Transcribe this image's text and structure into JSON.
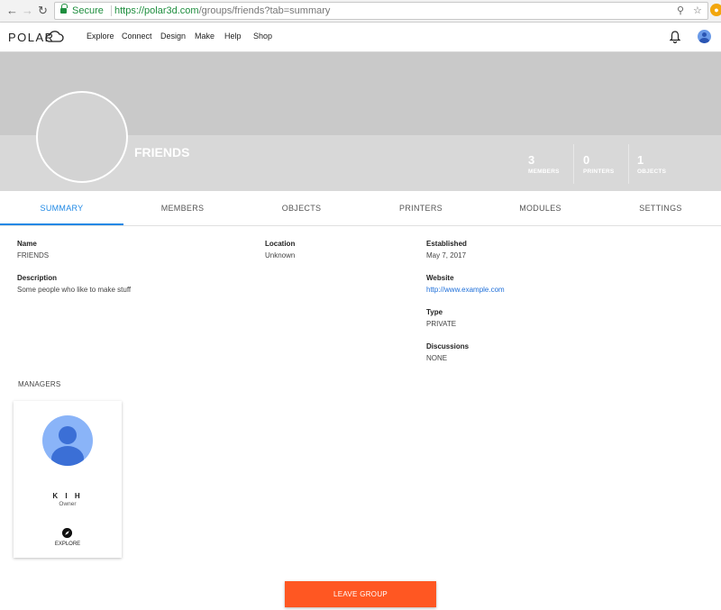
{
  "browser": {
    "back_icon": "arrow-left-icon",
    "forward_icon": "arrow-right-icon",
    "secure_label": "Secure",
    "url_host": "https://polar3d.com",
    "url_path": "/groups/friends?tab=summary"
  },
  "site": {
    "logo_text": "POLAR",
    "nav": [
      "Explore",
      "Connect",
      "Design",
      "Make",
      "Help",
      "Shop"
    ]
  },
  "group": {
    "name": "FRIENDS",
    "stats": [
      {
        "num": "3",
        "label": "MEMBERS"
      },
      {
        "num": "0",
        "label": "PRINTERS"
      },
      {
        "num": "1",
        "label": "OBJECTS"
      }
    ]
  },
  "tabs": [
    "SUMMARY",
    "MEMBERS",
    "OBJECTS",
    "PRINTERS",
    "MODULES",
    "SETTINGS"
  ],
  "active_tab": "SUMMARY",
  "summary": {
    "name_label": "Name",
    "name_value": "FRIENDS",
    "description_label": "Description",
    "description_value": "Some people who like to make stuff",
    "location_label": "Location",
    "location_value": "Unknown",
    "established_label": "Established",
    "established_value": "May 7, 2017",
    "website_label": "Website",
    "website_value": "http://www.example.com",
    "type_label": "Type",
    "type_value": "PRIVATE",
    "discussions_label": "Discussions",
    "discussions_value": "NONE"
  },
  "managers": {
    "heading": "MANAGERS",
    "card": {
      "name": "K I H",
      "role": "Owner",
      "explore_label": "EXPLORE"
    }
  },
  "leave_button": "LEAVE GROUP",
  "colors": {
    "accent": "#1e88e5",
    "leave": "#ff5722",
    "secure": "#1e8e3e"
  }
}
